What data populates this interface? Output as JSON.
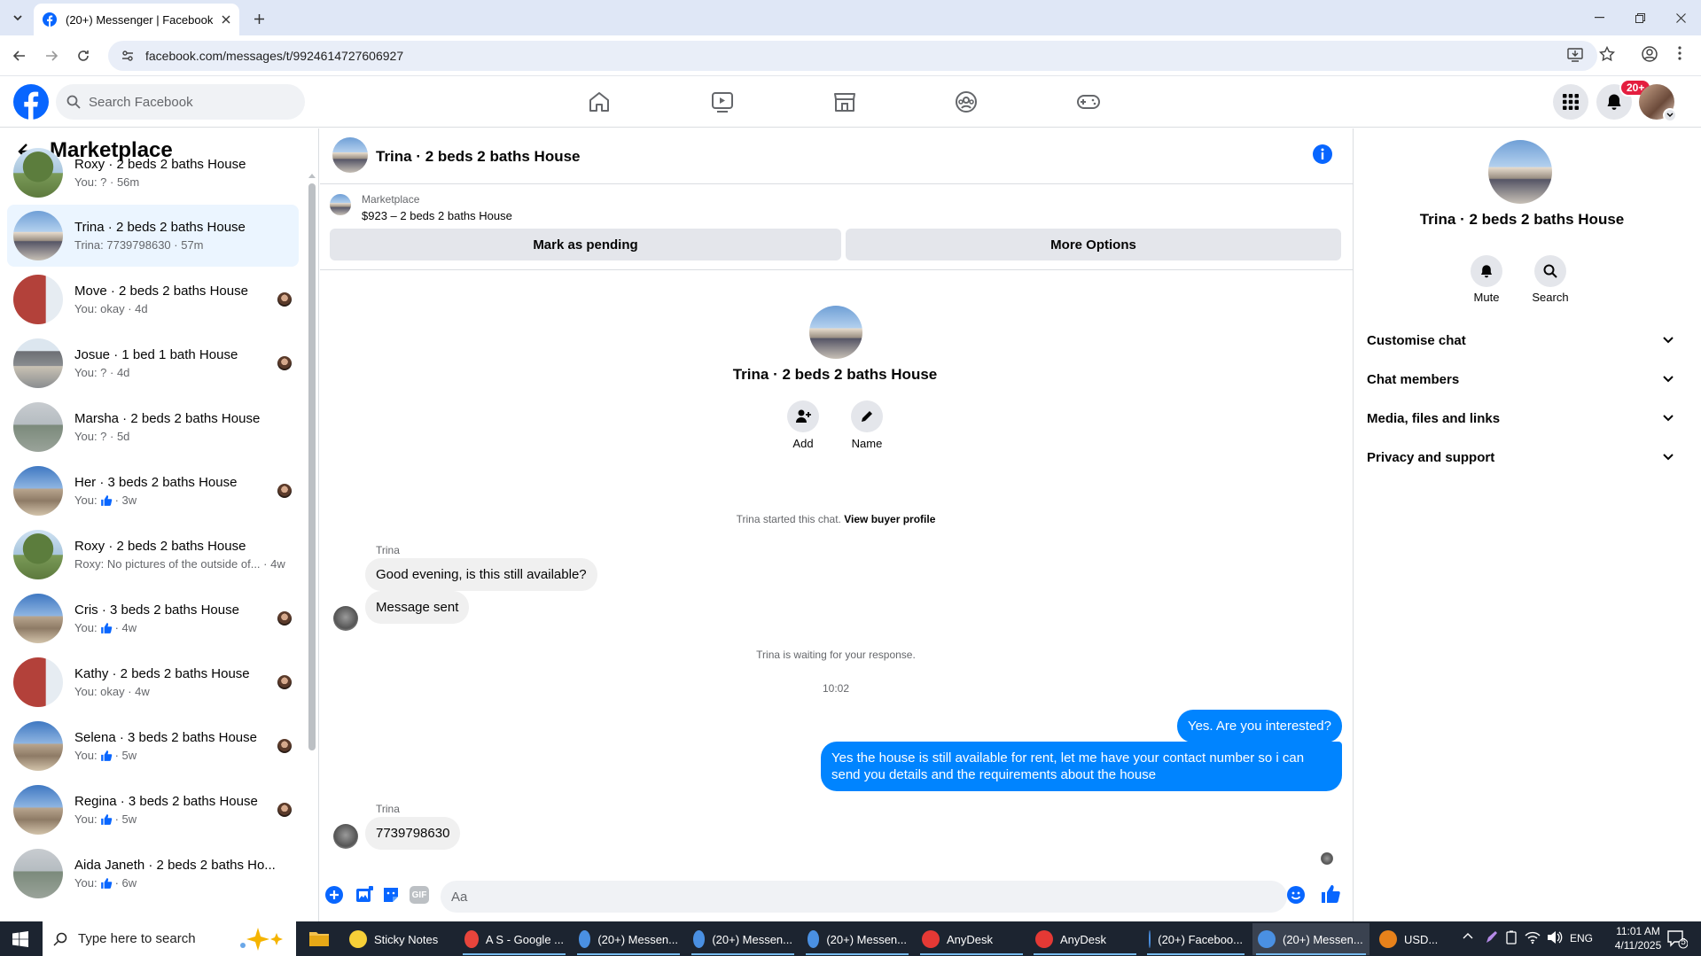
{
  "browser": {
    "tab_title": "(20+) Messenger | Facebook",
    "url": "facebook.com/messages/t/9924614727606927"
  },
  "fb": {
    "search_placeholder": "Search Facebook",
    "notification_badge": "20+"
  },
  "left": {
    "title": "Marketplace",
    "conversations": [
      {
        "name": "Roxy · 2 beds 2 baths House",
        "preview": "You: ? · 56m",
        "thumb": "tree"
      },
      {
        "name": "Trina · 2 beds 2 baths House",
        "preview": "Trina: 7739798630 · 57m",
        "thumb": "house",
        "active": true
      },
      {
        "name": "Move · 2 beds 2 baths House",
        "preview": "You: okay · 4d",
        "thumb": "brick"
      },
      {
        "name": "Josue · 1 bed 1 bath House",
        "preview": "You: ? · 4d",
        "thumb": "porch"
      },
      {
        "name": "Marsha · 2 beds 2 baths House",
        "preview": "You: ? · 5d",
        "thumb": "grey"
      },
      {
        "name": "Her · 3 beds 2 baths House",
        "preview_prefix": "You:",
        "preview_suffix": "· 3w",
        "thumb": "sky"
      },
      {
        "name": "Roxy · 2 beds 2 baths House",
        "preview": "Roxy: No pictures of the outside of... · 4w",
        "thumb": "tree"
      },
      {
        "name": "Cris · 3 beds 2 baths House",
        "preview_prefix": "You:",
        "preview_suffix": "· 4w",
        "thumb": "sky"
      },
      {
        "name": "Kathy · 2 beds 2 baths House",
        "preview": "You: okay · 4w",
        "thumb": "brick"
      },
      {
        "name": "Selena · 3 beds 2 baths House",
        "preview_prefix": "You:",
        "preview_suffix": "· 5w",
        "thumb": "sky"
      },
      {
        "name": "Regina · 3 beds 2 baths House",
        "preview_prefix": "You:",
        "preview_suffix": "· 5w",
        "thumb": "sky"
      },
      {
        "name": "Aida Janeth · 2 beds 2 baths Ho...",
        "preview_prefix": "You:",
        "preview_suffix": "· 6w",
        "thumb": "grey"
      }
    ]
  },
  "chat": {
    "title": "Trina · 2 beds 2 baths House",
    "mp_label": "Marketplace",
    "mp_listing": "$923 – 2 beds 2 baths House",
    "mark_pending": "Mark as pending",
    "more_options": "More Options",
    "center_title": "Trina · 2 beds 2 baths House",
    "add_label": "Add",
    "name_label": "Name",
    "started_text": "Trina started this chat.",
    "view_profile": "View buyer profile",
    "sender1": "Trina",
    "msg1": "Good evening, is this still available?",
    "msg2": "Message sent",
    "waiting": "Trina is waiting for your response.",
    "time": "10:02",
    "out1": "Yes. Are you interested?",
    "out2": "Yes the house is still available for rent, let me have your contact number so i can send you details and the requirements about the house",
    "sender2": "Trina",
    "msg3": "7739798630",
    "composer_placeholder": "Aa"
  },
  "right": {
    "title": "Trina · 2 beds 2 baths House",
    "mute": "Mute",
    "search": "Search",
    "sections": [
      "Customise chat",
      "Chat members",
      "Media, files and links",
      "Privacy and support"
    ]
  },
  "taskbar": {
    "search_placeholder": "Type here to search",
    "apps": [
      "Sticky Notes",
      "A S - Google ...",
      "(20+) Messen...",
      "(20+) Messen...",
      "(20+) Messen...",
      "AnyDesk",
      "AnyDesk",
      "(20+) Faceboo...",
      "(20+) Messen...",
      "USD..."
    ],
    "lang": "ENG",
    "clock_time": "11:01 AM",
    "clock_date": "4/11/2025",
    "notif_count": "5"
  },
  "colors": {
    "fb_blue": "#0866ff",
    "messenger_blue": "#0084ff",
    "badge_red": "#e41e3f"
  }
}
